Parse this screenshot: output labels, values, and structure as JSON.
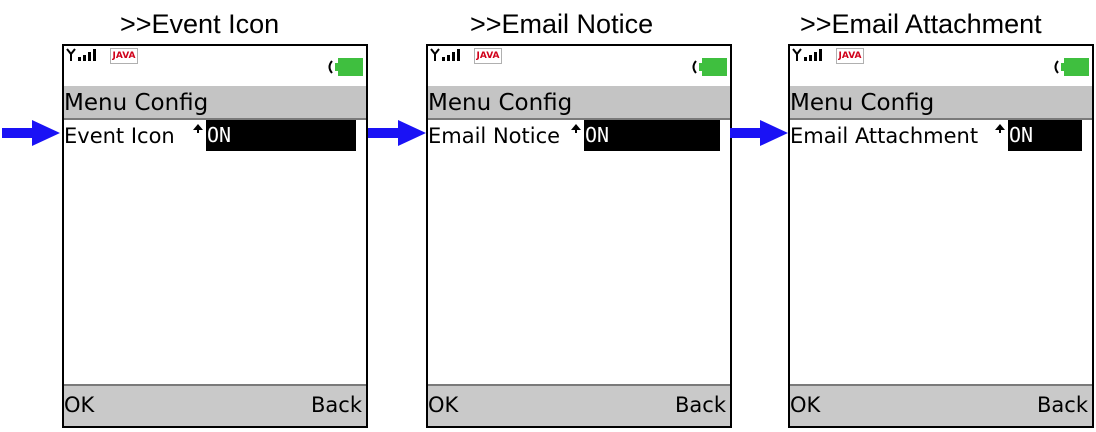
{
  "colors": {
    "pointer_arrow": "#1a12f5",
    "title_bar": "#c4c4c4",
    "softkey_bar": "#c9c9c9",
    "value_box": "#000000",
    "battery_fill": "#3fbf3f",
    "java_text": "#d0021b"
  },
  "panels": [
    {
      "caption": ">>Event Icon",
      "status": {
        "signal_icon": "signal-strength-icon",
        "java_badge": "JAVA",
        "battery_icon": "battery-icon"
      },
      "title": "Menu Config",
      "setting_label": "Event Icon",
      "setting_value": "ON",
      "softkeys": {
        "left": "OK",
        "right": "Back"
      }
    },
    {
      "caption": ">>Email Notice",
      "status": {
        "signal_icon": "signal-strength-icon",
        "java_badge": "JAVA",
        "battery_icon": "battery-icon"
      },
      "title": "Menu Config",
      "setting_label": "Email Notice",
      "setting_value": "ON",
      "softkeys": {
        "left": "OK",
        "right": "Back"
      }
    },
    {
      "caption": ">>Email Attachment",
      "status": {
        "signal_icon": "signal-strength-icon",
        "java_badge": "JAVA",
        "battery_icon": "battery-icon"
      },
      "title": "Menu Config",
      "setting_label": "Email Attachment",
      "setting_value": "ON",
      "softkeys": {
        "left": "OK",
        "right": "Back"
      }
    }
  ]
}
